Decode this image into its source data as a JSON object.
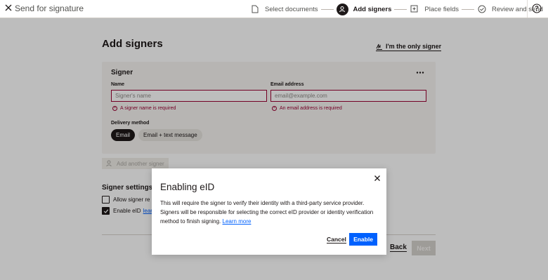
{
  "header": {
    "title": "Send for signature",
    "steps": [
      {
        "label": "Select documents",
        "icon": "document-icon",
        "active": false
      },
      {
        "label": "Add signers",
        "icon": "person-icon",
        "active": true
      },
      {
        "label": "Place fields",
        "icon": "place-fields-icon",
        "active": false
      },
      {
        "label": "Review and send",
        "icon": "check-circle-icon",
        "active": false
      }
    ]
  },
  "page": {
    "title": "Add signers",
    "only_signer_link": "I'm the only signer"
  },
  "signer_card": {
    "title": "Signer",
    "name_label": "Name",
    "name_placeholder": "Signer's name",
    "name_error": "A signer name is required",
    "email_label": "Email address",
    "email_placeholder": "email@example.com",
    "email_error": "An email address is required",
    "delivery_label": "Delivery method",
    "delivery_options": [
      "Email",
      "Email + text message"
    ],
    "delivery_selected": "Email"
  },
  "add_another": "Add another signer",
  "settings": {
    "title": "Signer settings",
    "allow_label": "Allow signer re",
    "allow_checked": false,
    "eid_label": "Enable eID",
    "eid_link": "lear",
    "eid_checked": true
  },
  "footer": {
    "back": "Back",
    "next": "Next"
  },
  "modal": {
    "title": "Enabling eID",
    "body": "This will require the signer to verify their identity with a third-party service provider. Signers will be responsible for selecting the correct eID provider or identity verification method to finish signing.",
    "link": "Learn more",
    "cancel": "Cancel",
    "enable": "Enable"
  },
  "colors": {
    "primary": "#0061fe",
    "error": "#9b0032",
    "text": "#1e1919",
    "card_bg": "#f7f5f2"
  }
}
